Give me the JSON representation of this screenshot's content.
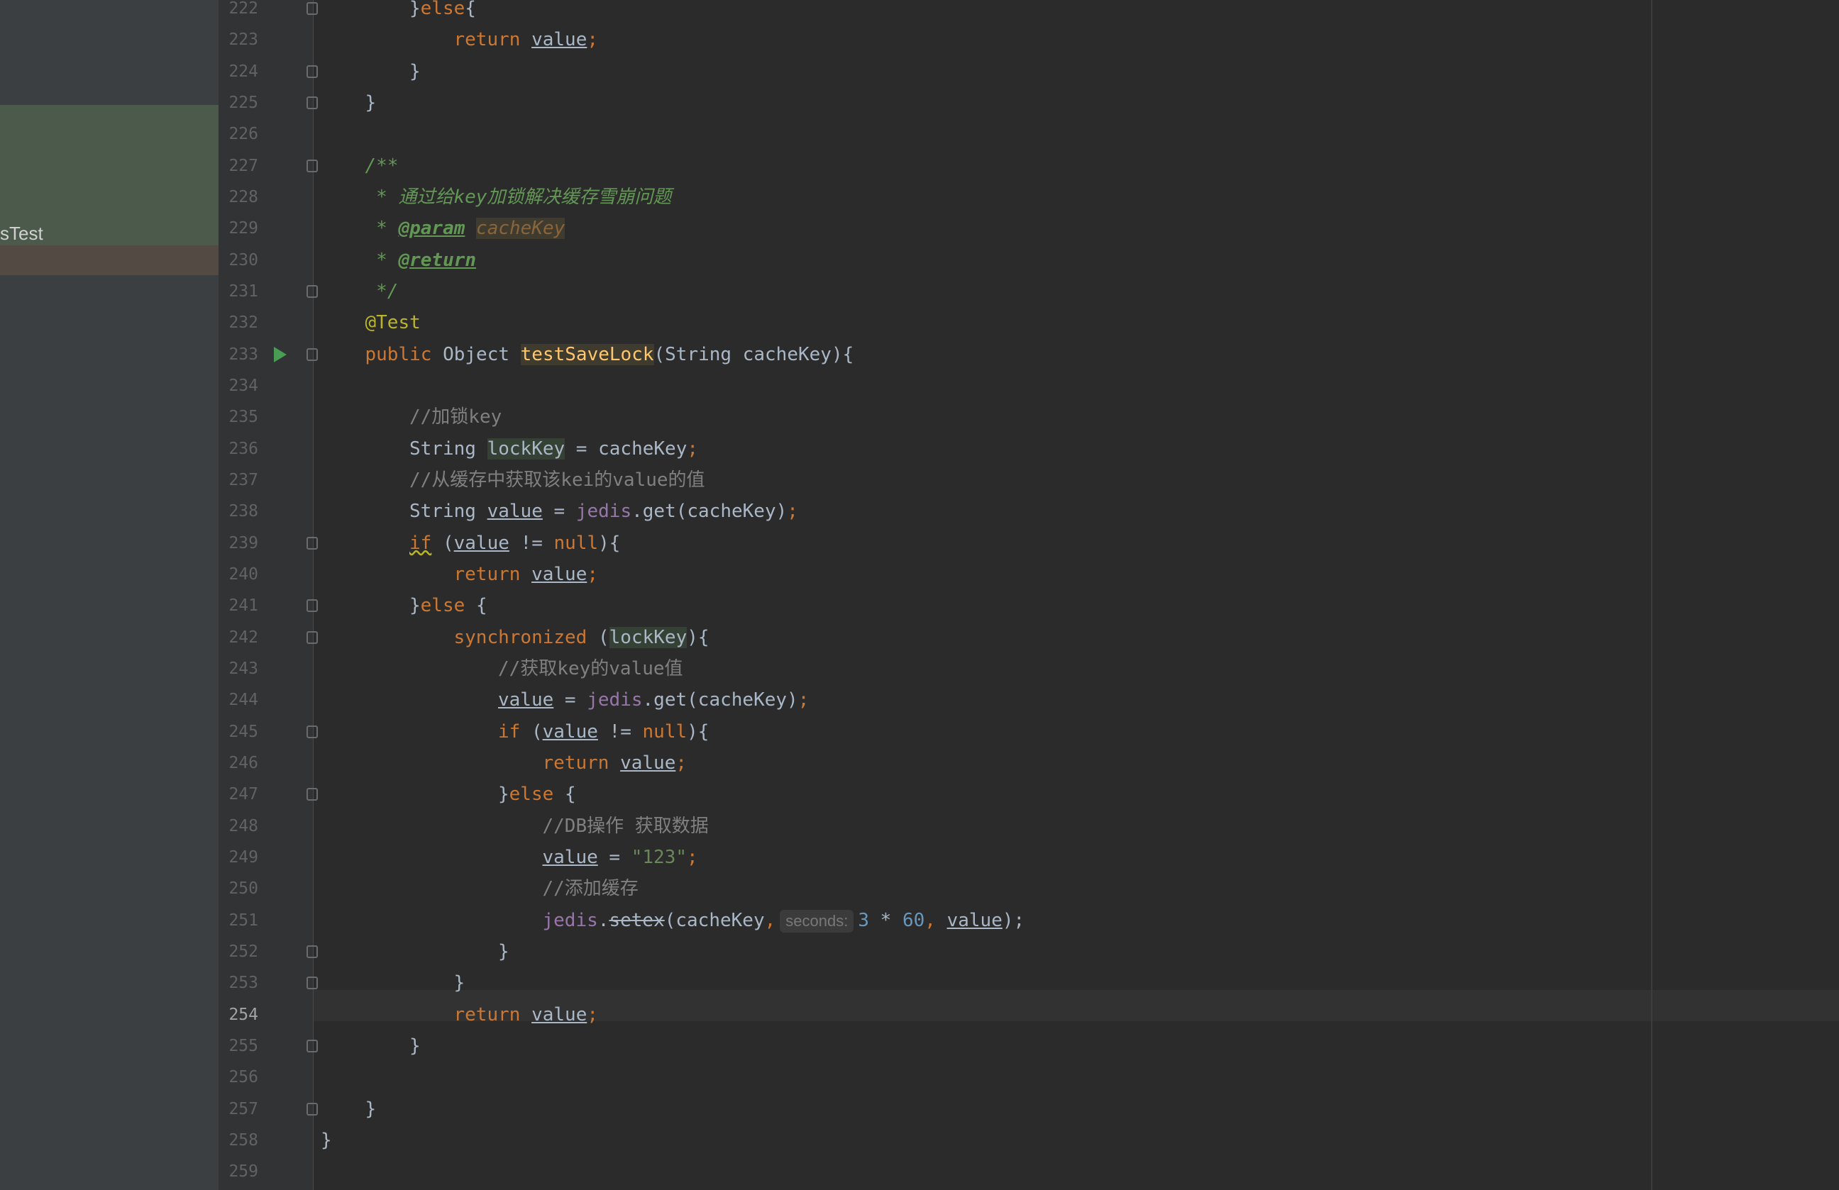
{
  "sidebar": {
    "selected_item_label": "sTest"
  },
  "editor": {
    "current_line": 254,
    "lines": [
      {
        "n": 222,
        "i": 2,
        "tokens": [
          {
            "t": "}",
            "c": "plain"
          },
          {
            "t": "else",
            "c": "kw"
          },
          {
            "t": "{",
            "c": "plain"
          }
        ]
      },
      {
        "n": 223,
        "i": 3,
        "tokens": [
          {
            "t": "return ",
            "c": "kw"
          },
          {
            "t": "value",
            "c": "var"
          },
          {
            "t": ";",
            "c": "kw"
          }
        ]
      },
      {
        "n": 224,
        "i": 2,
        "tokens": [
          {
            "t": "}",
            "c": "plain"
          }
        ]
      },
      {
        "n": 225,
        "i": 1,
        "tokens": [
          {
            "t": "}",
            "c": "plain"
          }
        ]
      },
      {
        "n": 226,
        "i": 0,
        "tokens": []
      },
      {
        "n": 227,
        "i": 1,
        "tokens": [
          {
            "t": "/**",
            "c": "doc"
          }
        ]
      },
      {
        "n": 228,
        "i": 1,
        "tokens": [
          {
            "t": " * 通过给key加锁解决缓存雪崩问题",
            "c": "doc"
          }
        ]
      },
      {
        "n": 229,
        "i": 1,
        "tokens": [
          {
            "t": " * ",
            "c": "doc"
          },
          {
            "t": "@param",
            "c": "doctag"
          },
          {
            "t": " ",
            "c": "doc"
          },
          {
            "t": "cacheKey",
            "c": "docparam"
          }
        ]
      },
      {
        "n": 230,
        "i": 1,
        "tokens": [
          {
            "t": " * ",
            "c": "doc"
          },
          {
            "t": "@return",
            "c": "doctag"
          }
        ]
      },
      {
        "n": 231,
        "i": 1,
        "tokens": [
          {
            "t": " */",
            "c": "doc"
          }
        ]
      },
      {
        "n": 232,
        "i": 1,
        "tokens": [
          {
            "t": "@Test",
            "c": "anno"
          }
        ]
      },
      {
        "n": 233,
        "i": 1,
        "tokens": [
          {
            "t": "public ",
            "c": "kw"
          },
          {
            "t": "Object ",
            "c": "plain"
          },
          {
            "t": "testSaveLock",
            "c": "hlmethod"
          },
          {
            "t": "(String cacheKey){",
            "c": "plain"
          }
        ]
      },
      {
        "n": 234,
        "i": 0,
        "tokens": []
      },
      {
        "n": 235,
        "i": 2,
        "tokens": [
          {
            "t": "//加锁key",
            "c": "cmt"
          }
        ]
      },
      {
        "n": 236,
        "i": 2,
        "tokens": [
          {
            "t": "String ",
            "c": "plain"
          },
          {
            "t": "lockKey",
            "c": "hlref"
          },
          {
            "t": " = cacheKey",
            "c": "plain"
          },
          {
            "t": ";",
            "c": "kw"
          }
        ]
      },
      {
        "n": 237,
        "i": 2,
        "tokens": [
          {
            "t": "//从缓存中获取该kei的value的值",
            "c": "cmt"
          }
        ]
      },
      {
        "n": 238,
        "i": 2,
        "tokens": [
          {
            "t": "String ",
            "c": "plain"
          },
          {
            "t": "value",
            "c": "var"
          },
          {
            "t": " = ",
            "c": "plain"
          },
          {
            "t": "jedis",
            "c": "fld"
          },
          {
            "t": ".get(cacheKey)",
            "c": "plain"
          },
          {
            "t": ";",
            "c": "kw"
          }
        ]
      },
      {
        "n": 239,
        "i": 2,
        "tokens": [
          {
            "t": "if",
            "c": "kw squig"
          },
          {
            "t": " (",
            "c": "plain"
          },
          {
            "t": "value",
            "c": "var"
          },
          {
            "t": " != ",
            "c": "plain"
          },
          {
            "t": "null",
            "c": "kw"
          },
          {
            "t": "){",
            "c": "plain"
          }
        ]
      },
      {
        "n": 240,
        "i": 3,
        "tokens": [
          {
            "t": "return ",
            "c": "kw"
          },
          {
            "t": "value",
            "c": "var"
          },
          {
            "t": ";",
            "c": "kw"
          }
        ]
      },
      {
        "n": 241,
        "i": 2,
        "tokens": [
          {
            "t": "}",
            "c": "plain"
          },
          {
            "t": "else ",
            "c": "kw"
          },
          {
            "t": "{",
            "c": "plain"
          }
        ]
      },
      {
        "n": 242,
        "i": 3,
        "tokens": [
          {
            "t": "synchronized ",
            "c": "kw"
          },
          {
            "t": "(",
            "c": "plain"
          },
          {
            "t": "lockKey",
            "c": "hlref"
          },
          {
            "t": "){",
            "c": "plain"
          }
        ]
      },
      {
        "n": 243,
        "i": 4,
        "tokens": [
          {
            "t": "//获取key的value值",
            "c": "cmt"
          }
        ]
      },
      {
        "n": 244,
        "i": 4,
        "tokens": [
          {
            "t": "value",
            "c": "var"
          },
          {
            "t": " = ",
            "c": "plain"
          },
          {
            "t": "jedis",
            "c": "fld"
          },
          {
            "t": ".get(cacheKey)",
            "c": "plain"
          },
          {
            "t": ";",
            "c": "kw"
          }
        ]
      },
      {
        "n": 245,
        "i": 4,
        "tokens": [
          {
            "t": "if ",
            "c": "kw"
          },
          {
            "t": "(",
            "c": "plain"
          },
          {
            "t": "value",
            "c": "var"
          },
          {
            "t": " != ",
            "c": "plain"
          },
          {
            "t": "null",
            "c": "kw"
          },
          {
            "t": "){",
            "c": "plain"
          }
        ]
      },
      {
        "n": 246,
        "i": 5,
        "tokens": [
          {
            "t": "return ",
            "c": "kw"
          },
          {
            "t": "value",
            "c": "var"
          },
          {
            "t": ";",
            "c": "kw"
          }
        ]
      },
      {
        "n": 247,
        "i": 4,
        "tokens": [
          {
            "t": "}",
            "c": "plain"
          },
          {
            "t": "else ",
            "c": "kw"
          },
          {
            "t": "{",
            "c": "plain"
          }
        ]
      },
      {
        "n": 248,
        "i": 5,
        "tokens": [
          {
            "t": "//DB操作 获取数据",
            "c": "cmt"
          }
        ]
      },
      {
        "n": 249,
        "i": 5,
        "tokens": [
          {
            "t": "value",
            "c": "var"
          },
          {
            "t": " = ",
            "c": "plain"
          },
          {
            "t": "\"123\"",
            "c": "str"
          },
          {
            "t": ";",
            "c": "kw"
          }
        ]
      },
      {
        "n": 250,
        "i": 5,
        "tokens": [
          {
            "t": "//添加缓存",
            "c": "cmt"
          }
        ]
      },
      {
        "n": 251,
        "i": 5,
        "tokens": [
          {
            "t": "jedis",
            "c": "fld"
          },
          {
            "t": ".",
            "c": "plain"
          },
          {
            "t": "setex",
            "c": "strike"
          },
          {
            "t": "(cacheKey",
            "c": "plain"
          },
          {
            "t": ",",
            "c": "kw"
          },
          {
            "t": "seconds:",
            "c": "hint"
          },
          {
            "t": "3",
            "c": "num"
          },
          {
            "t": " * ",
            "c": "plain"
          },
          {
            "t": "60",
            "c": "num"
          },
          {
            "t": ", ",
            "c": "kw"
          },
          {
            "t": "value",
            "c": "var"
          },
          {
            "t": ");",
            "c": "plain"
          }
        ]
      },
      {
        "n": 252,
        "i": 4,
        "tokens": [
          {
            "t": "}",
            "c": "plain"
          }
        ]
      },
      {
        "n": 253,
        "i": 3,
        "tokens": [
          {
            "t": "}",
            "c": "plain"
          }
        ]
      },
      {
        "n": 254,
        "i": 3,
        "tokens": [
          {
            "t": "return ",
            "c": "kw"
          },
          {
            "t": "value",
            "c": "var"
          },
          {
            "t": ";",
            "c": "kw"
          }
        ]
      },
      {
        "n": 255,
        "i": 2,
        "tokens": [
          {
            "t": "}",
            "c": "plain"
          }
        ]
      },
      {
        "n": 256,
        "i": 0,
        "tokens": []
      },
      {
        "n": 257,
        "i": 1,
        "tokens": [
          {
            "t": "}",
            "c": "plain"
          }
        ]
      },
      {
        "n": 258,
        "i": 0,
        "tokens": [
          {
            "t": "}",
            "c": "plain"
          }
        ]
      },
      {
        "n": 259,
        "i": 0,
        "tokens": []
      }
    ],
    "fold_lines": [
      222,
      224,
      225,
      227,
      231,
      233,
      239,
      241,
      242,
      245,
      247,
      252,
      253,
      255,
      257
    ],
    "run_icon_line": 233,
    "colors": {
      "background": "#2b2b2b",
      "keyword": "#cc7832",
      "doc_comment": "#629755",
      "comment": "#808080",
      "annotation": "#bbb529",
      "field": "#9876aa",
      "number": "#6897bb",
      "string": "#6a8759",
      "method_decl": "#ffc66d"
    }
  }
}
